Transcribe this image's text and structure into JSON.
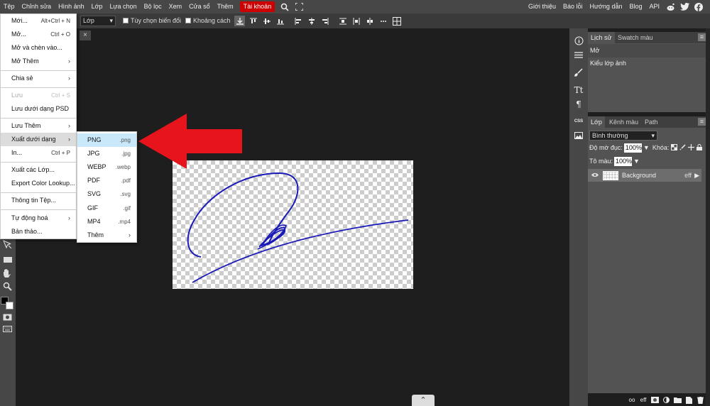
{
  "menubar": {
    "items": [
      "Tệp",
      "Chỉnh sửa",
      "Hình ảnh",
      "Lớp",
      "Lựa chọn",
      "Bộ lọc",
      "Xem",
      "Cửa sổ",
      "Thêm",
      "Tài khoản"
    ],
    "right_links": [
      "Giới thiệu",
      "Báo lỗi",
      "Hướng dẫn",
      "Blog",
      "API"
    ]
  },
  "optbar": {
    "select_value": "Lớp",
    "check1": "Tùy chọn biến đổi",
    "check2": "Khoảng cách"
  },
  "file_menu": {
    "items": [
      {
        "label": "Mới...",
        "shortcut": "Alt+Ctrl + N"
      },
      {
        "label": "Mở...",
        "shortcut": "Ctrl + O"
      },
      {
        "label": "Mở và chèn vào...",
        "shortcut": ""
      },
      {
        "label": "Mở Thêm",
        "shortcut": ""
      },
      {
        "label": "Chia sẻ",
        "shortcut": ""
      },
      {
        "label": "Lưu",
        "shortcut": "Ctrl + S"
      },
      {
        "label": "Lưu dưới dạng PSD",
        "shortcut": ""
      },
      {
        "label": "Lưu Thêm",
        "shortcut": ""
      },
      {
        "label": "Xuất dưới dạng",
        "shortcut": ""
      },
      {
        "label": "In...",
        "shortcut": "Ctrl + P"
      },
      {
        "label": "Xuất các Lớp...",
        "shortcut": ""
      },
      {
        "label": "Export Color Lookup...",
        "shortcut": ""
      },
      {
        "label": "Thông tin Tệp...",
        "shortcut": ""
      },
      {
        "label": "Tự động hoá",
        "shortcut": ""
      },
      {
        "label": "Bản thảo...",
        "shortcut": ""
      }
    ]
  },
  "export_submenu": {
    "items": [
      {
        "label": "PNG",
        "ext": ".png"
      },
      {
        "label": "JPG",
        "ext": ".jpg"
      },
      {
        "label": "WEBP",
        "ext": ".webp"
      },
      {
        "label": "PDF",
        "ext": ".pdf"
      },
      {
        "label": "SVG",
        "ext": ".svg"
      },
      {
        "label": "GIF",
        "ext": ".gif"
      },
      {
        "label": "MP4",
        "ext": ".mp4"
      },
      {
        "label": "Thêm",
        "ext": ""
      }
    ]
  },
  "history_panel": {
    "tabs": [
      "Lịch sử",
      "Swatch màu"
    ],
    "items": [
      "Mở",
      "Kiểu lớp ảnh"
    ]
  },
  "layers_panel": {
    "tabs": [
      "Lớp",
      "Kênh màu",
      "Path"
    ],
    "blend_mode": "Bình thường",
    "opacity_label": "Độ mờ đục:",
    "opacity_value": "100%",
    "lock_label": "Khóa:",
    "fill_label": "Tô màu:",
    "fill_value": "100%",
    "layer_name": "Background",
    "layer_fx": "eff"
  },
  "bottom": {
    "eff": "eff",
    "link": "oo"
  },
  "colors": {
    "accent": "#cc0000",
    "arrow": "#e8141c",
    "stroke": "#1a1ab8",
    "highlight": "#c9e8fa"
  }
}
